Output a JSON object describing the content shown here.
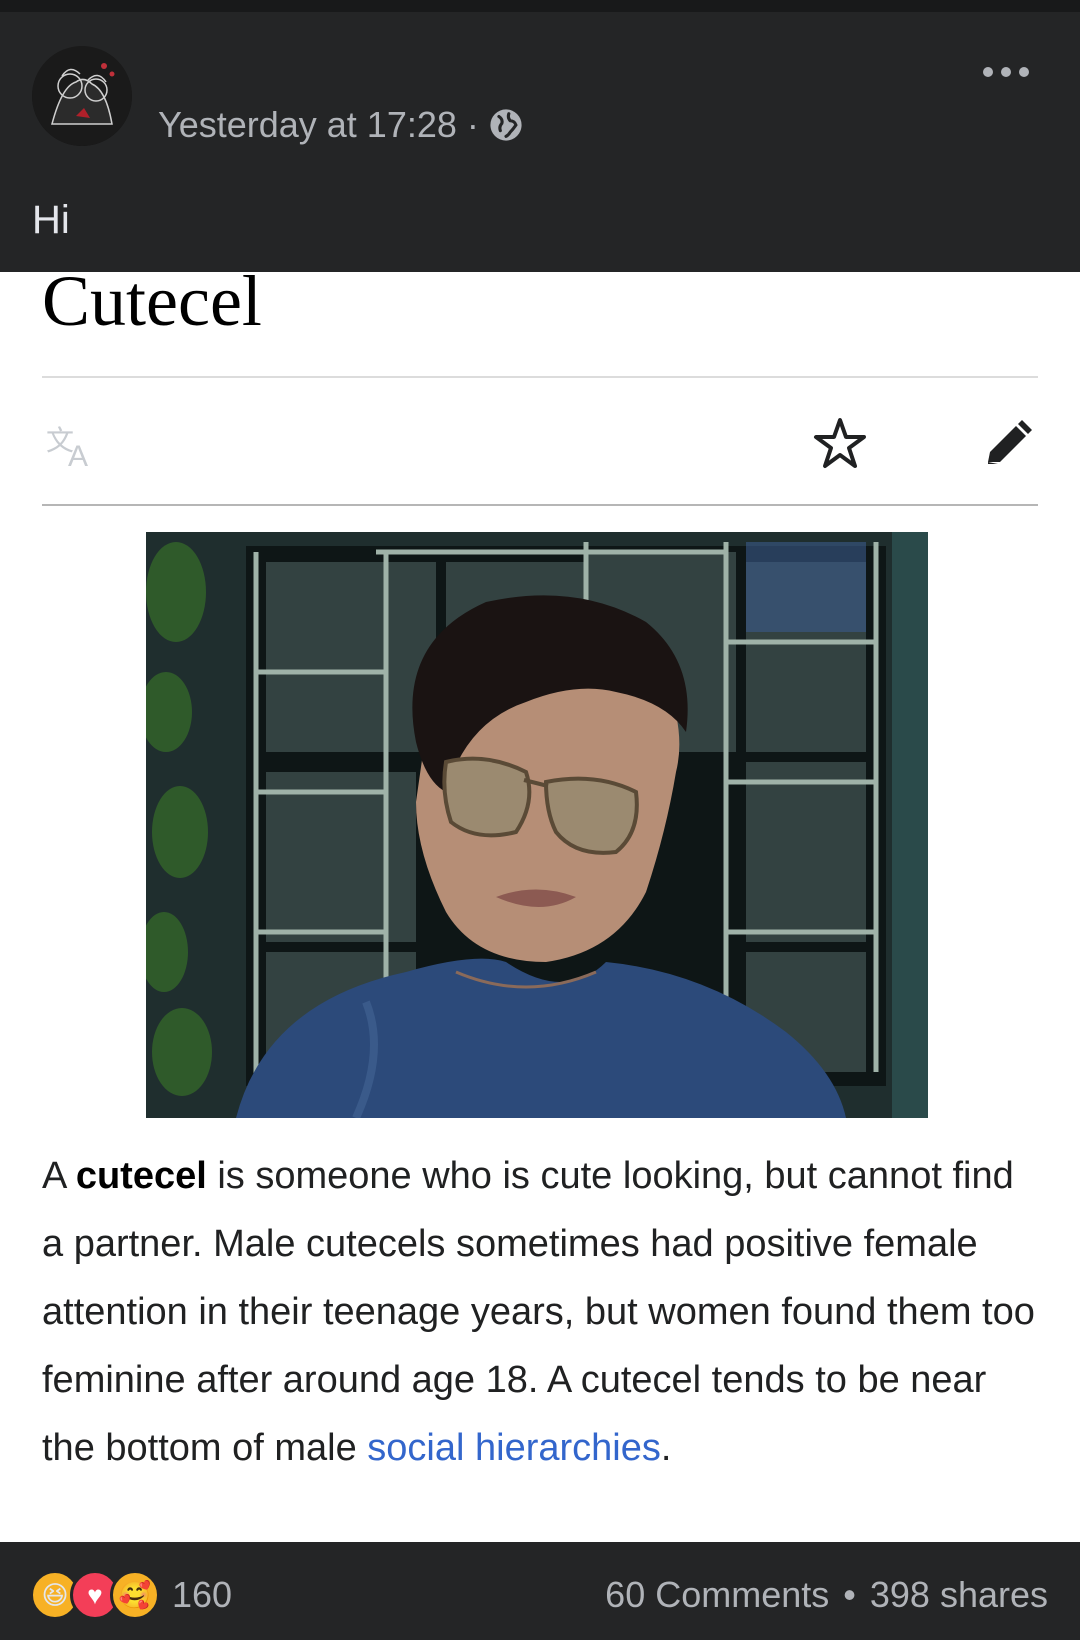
{
  "post": {
    "timestamp": "Yesterday at 17:28",
    "separator": "·",
    "privacy_icon": "globe-icon",
    "text": "Hi",
    "more_icon": "more-dots-icon"
  },
  "wiki": {
    "title": "Cutecel",
    "icons": [
      "translate-icon",
      "star-icon",
      "pencil-icon"
    ],
    "desc_lead": "A ",
    "desc_bold": "cutecel",
    "desc_body": " is someone who is cute looking, but cannot find a partner. Male cutecels sometimes had positive female attention in their teenage years, but women found them too feminine after around age 18. A cutecel tends to be near the bottom of male ",
    "desc_link": "social hierarchies",
    "desc_end": "."
  },
  "footer": {
    "reaction_icons": [
      "haha-icon",
      "love-icon",
      "care-icon"
    ],
    "reaction_count": "160",
    "comments": "60 Comments",
    "bullet": "•",
    "shares": "398 shares"
  },
  "colors": {
    "background": "#242526",
    "secondary_text": "#b0b3b8",
    "link": "#3366cc"
  }
}
